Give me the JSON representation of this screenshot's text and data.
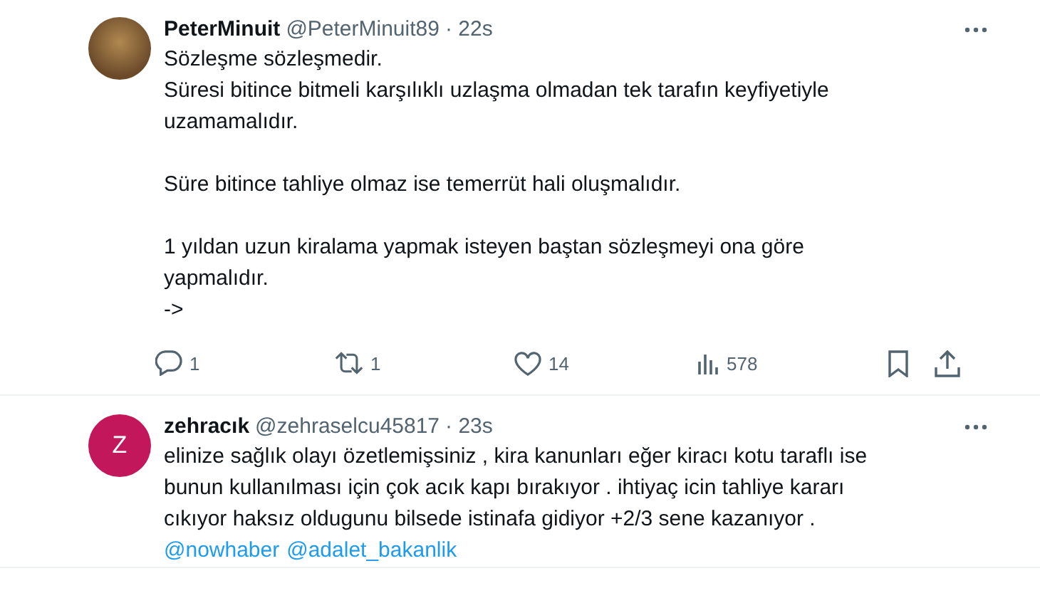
{
  "tweets": [
    {
      "author": "PeterMinuit",
      "handle": "@PeterMinuit89",
      "time": "· 22s",
      "avatar": {
        "kind": "photo"
      },
      "paragraphs": [
        "Sözleşme sözleşmedir.\nSüresi bitince bitmeli karşılıklı uzlaşma olmadan tek tarafın keyfiyetiyle\nuzamamalıdır.",
        "Süre bitince tahliye olmaz ise temerrüt hali oluşmalıdır.",
        "1 yıldan uzun kiralama yapmak isteyen baştan sözleşmeyi ona göre\nyapmalıdır.\n->"
      ],
      "actions": [
        {
          "kind": "reply",
          "count": "1"
        },
        {
          "kind": "retweet",
          "count": "1"
        },
        {
          "kind": "like",
          "count": "14"
        },
        {
          "kind": "views",
          "count": "578"
        },
        {
          "kind": "bookmark"
        },
        {
          "kind": "share"
        }
      ]
    },
    {
      "author": "zehracık",
      "handle": "@zehraselcu45817",
      "time": "· 23s",
      "avatar": {
        "kind": "letter",
        "letter": "Z",
        "color": "#c2185b"
      },
      "paragraphs": [
        "elinize sağlık olayı özetlemişsiniz , kira kanunları eğer kiracı kotu taraflı ise\nbunun kullanılması için çok acık kapı bırakıyor . ihtiyaç icin tahliye kararı\ncıkıyor haksız oldugunu bilsede istinafa gidiyor +2/3 sene kazanıyor ."
      ],
      "mentions": [
        "@nowhaber",
        "@adalet_bakanlik"
      ]
    }
  ]
}
